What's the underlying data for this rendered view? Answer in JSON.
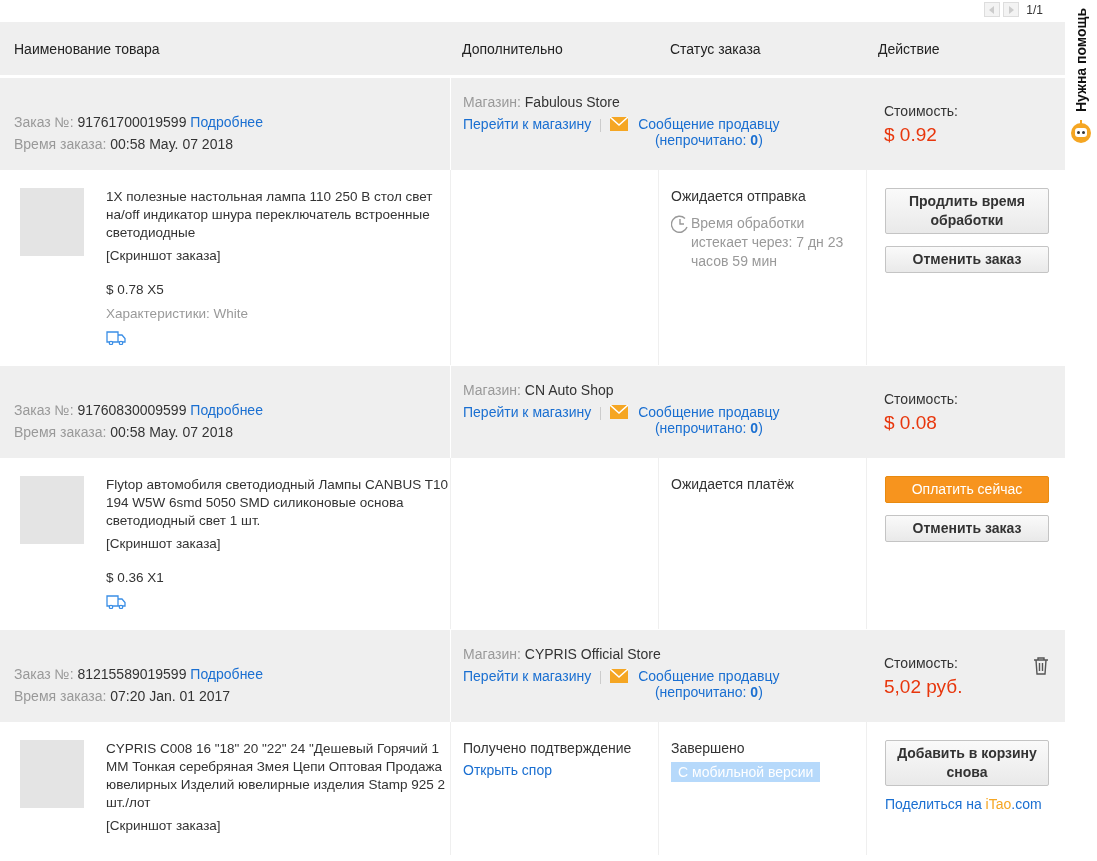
{
  "pager": {
    "text": "1/1"
  },
  "columns": [
    "Наименование товара",
    "Дополнительно",
    "Статус заказа",
    "Действие"
  ],
  "help": {
    "label": "Нужна помощь"
  },
  "orders": [
    {
      "number_label": "Заказ №:",
      "number": "91761700019599",
      "details": "Подробнее",
      "time_label": "Время заказа:",
      "time": "00:58 May. 07 2018",
      "store_label": "Магазин:",
      "store": "Fabulous Store",
      "store_link": "Перейти к магазину",
      "message_link": "Сообщение продавцу",
      "unread_label": "(непрочитано: ",
      "unread": "0",
      "unread_end": ")",
      "cost_label": "Стоимость:",
      "cost": "$ 0.92",
      "item": {
        "title": "1X полезные настольная лампа 110 250 В стол свет на/off индикатор шнура переключатель встроенные светодиодные",
        "snapshot": "[Скриншот заказа]",
        "price": "$ 0.78 X5",
        "specs": "Характеристики: White",
        "shipping_icon": true,
        "status": "Ожидается отправка",
        "timer": "Время обработки истекает через: 7 дн 23 часов 59 мин",
        "buttons": [
          {
            "label": "Продлить время обработки",
            "kind": "default"
          },
          {
            "label": "Отменить заказ",
            "kind": "default"
          }
        ]
      }
    },
    {
      "number_label": "Заказ №:",
      "number": "91760830009599",
      "details": "Подробнее",
      "time_label": "Время заказа:",
      "time": "00:58 May. 07 2018",
      "store_label": "Магазин:",
      "store": "CN Auto Shop",
      "store_link": "Перейти к магазину",
      "message_link": "Сообщение продавцу",
      "unread_label": "(непрочитано: ",
      "unread": "0",
      "unread_end": ")",
      "cost_label": "Стоимость:",
      "cost": "$ 0.08",
      "item": {
        "title": "Flytop автомобиля светодиодный Лампы CANBUS T10 194 W5W 6smd 5050 SMD силиконовые основа светодиодный свет 1 шт.",
        "snapshot": "[Скриншот заказа]",
        "price": "$ 0.36 X1",
        "shipping_icon": true,
        "status": "Ожидается платёж",
        "buttons": [
          {
            "label": "Оплатить сейчас",
            "kind": "primary"
          },
          {
            "label": "Отменить заказ",
            "kind": "default"
          }
        ]
      }
    },
    {
      "number_label": "Заказ №:",
      "number": "81215589019599",
      "details": "Подробнее",
      "time_label": "Время заказа:",
      "time": "07:20 Jan. 01 2017",
      "store_label": "Магазин:",
      "store": "CYPRIS Official Store",
      "store_link": "Перейти к магазину",
      "message_link": "Сообщение продавцу",
      "unread_label": "(непрочитано: ",
      "unread": "0",
      "unread_end": ")",
      "cost_label": "Стоимость:",
      "cost": "5,02 руб.",
      "deletable": true,
      "item": {
        "title": "CYPRIS C008 16 \"18\" 20 \"22\" 24 \"Дешевый Горячий 1 MM Тонкая серебряная Змея Цепи Оптовая Продажа ювелирных Изделий ювелирные изделия Stamp 925 2 шт./лот",
        "snapshot": "[Скриншот заказа]",
        "extra": [
          {
            "kind": "text",
            "text": "Получено подтверждение"
          },
          {
            "kind": "link",
            "text": "Открыть спор"
          }
        ],
        "status": "Завершено",
        "mobile_badge": "С мобильной версии",
        "buttons": [
          {
            "label": "Добавить в корзину снова",
            "kind": "default"
          }
        ],
        "share": {
          "prefix": "Поделиться на ",
          "brand": "iTao",
          "suffix": ".com"
        }
      }
    }
  ]
}
